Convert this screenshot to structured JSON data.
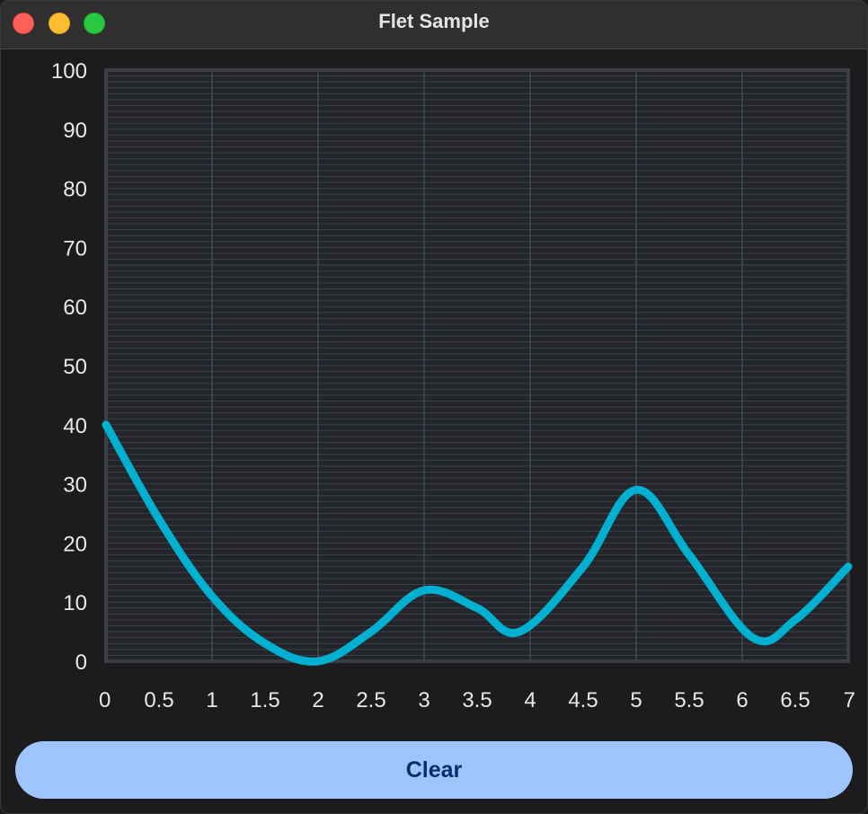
{
  "window": {
    "title": "Flet Sample"
  },
  "button": {
    "label": "Clear"
  },
  "colors": {
    "line": "#00b0d0",
    "button_bg": "#9fc5ff",
    "button_text": "#0a2d6a",
    "background": "#1c1c1e"
  },
  "chart_data": {
    "type": "line",
    "xlim": [
      0,
      7
    ],
    "ylim": [
      0,
      100
    ],
    "x_ticks": [
      "0",
      "0.5",
      "1",
      "1.5",
      "2",
      "2.5",
      "3",
      "3.5",
      "4",
      "4.5",
      "5",
      "5.5",
      "6",
      "6.5",
      "7"
    ],
    "y_ticks": [
      "0",
      "10",
      "20",
      "30",
      "40",
      "50",
      "60",
      "70",
      "80",
      "90",
      "100"
    ],
    "grid": true,
    "curved": true,
    "series": [
      {
        "x": [
          0,
          0.5,
          1,
          1.5,
          2,
          2.5,
          3,
          3.5,
          3.9,
          4.5,
          5,
          5.5,
          6.1,
          6.5,
          7
        ],
        "y": [
          40,
          24,
          11,
          3,
          0,
          5,
          12,
          9,
          5,
          16,
          29,
          18,
          4,
          7,
          16
        ]
      }
    ]
  }
}
